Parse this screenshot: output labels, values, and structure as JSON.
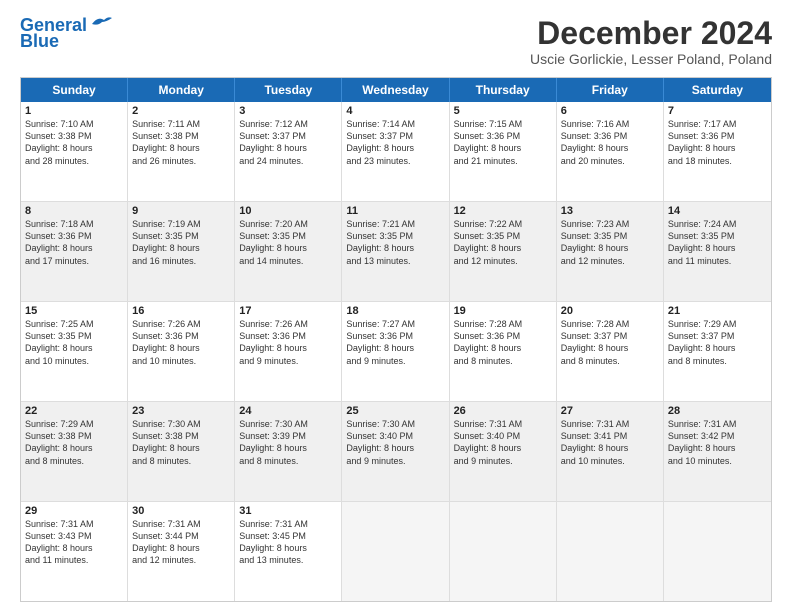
{
  "header": {
    "logo_line1": "General",
    "logo_line2": "Blue",
    "month_year": "December 2024",
    "location": "Uscie Gorlickie, Lesser Poland, Poland"
  },
  "weekdays": [
    "Sunday",
    "Monday",
    "Tuesday",
    "Wednesday",
    "Thursday",
    "Friday",
    "Saturday"
  ],
  "rows": [
    [
      {
        "day": "1",
        "lines": [
          "Sunrise: 7:10 AM",
          "Sunset: 3:38 PM",
          "Daylight: 8 hours",
          "and 28 minutes."
        ]
      },
      {
        "day": "2",
        "lines": [
          "Sunrise: 7:11 AM",
          "Sunset: 3:38 PM",
          "Daylight: 8 hours",
          "and 26 minutes."
        ]
      },
      {
        "day": "3",
        "lines": [
          "Sunrise: 7:12 AM",
          "Sunset: 3:37 PM",
          "Daylight: 8 hours",
          "and 24 minutes."
        ]
      },
      {
        "day": "4",
        "lines": [
          "Sunrise: 7:14 AM",
          "Sunset: 3:37 PM",
          "Daylight: 8 hours",
          "and 23 minutes."
        ]
      },
      {
        "day": "5",
        "lines": [
          "Sunrise: 7:15 AM",
          "Sunset: 3:36 PM",
          "Daylight: 8 hours",
          "and 21 minutes."
        ]
      },
      {
        "day": "6",
        "lines": [
          "Sunrise: 7:16 AM",
          "Sunset: 3:36 PM",
          "Daylight: 8 hours",
          "and 20 minutes."
        ]
      },
      {
        "day": "7",
        "lines": [
          "Sunrise: 7:17 AM",
          "Sunset: 3:36 PM",
          "Daylight: 8 hours",
          "and 18 minutes."
        ]
      }
    ],
    [
      {
        "day": "8",
        "lines": [
          "Sunrise: 7:18 AM",
          "Sunset: 3:36 PM",
          "Daylight: 8 hours",
          "and 17 minutes."
        ]
      },
      {
        "day": "9",
        "lines": [
          "Sunrise: 7:19 AM",
          "Sunset: 3:35 PM",
          "Daylight: 8 hours",
          "and 16 minutes."
        ]
      },
      {
        "day": "10",
        "lines": [
          "Sunrise: 7:20 AM",
          "Sunset: 3:35 PM",
          "Daylight: 8 hours",
          "and 14 minutes."
        ]
      },
      {
        "day": "11",
        "lines": [
          "Sunrise: 7:21 AM",
          "Sunset: 3:35 PM",
          "Daylight: 8 hours",
          "and 13 minutes."
        ]
      },
      {
        "day": "12",
        "lines": [
          "Sunrise: 7:22 AM",
          "Sunset: 3:35 PM",
          "Daylight: 8 hours",
          "and 12 minutes."
        ]
      },
      {
        "day": "13",
        "lines": [
          "Sunrise: 7:23 AM",
          "Sunset: 3:35 PM",
          "Daylight: 8 hours",
          "and 12 minutes."
        ]
      },
      {
        "day": "14",
        "lines": [
          "Sunrise: 7:24 AM",
          "Sunset: 3:35 PM",
          "Daylight: 8 hours",
          "and 11 minutes."
        ]
      }
    ],
    [
      {
        "day": "15",
        "lines": [
          "Sunrise: 7:25 AM",
          "Sunset: 3:35 PM",
          "Daylight: 8 hours",
          "and 10 minutes."
        ]
      },
      {
        "day": "16",
        "lines": [
          "Sunrise: 7:26 AM",
          "Sunset: 3:36 PM",
          "Daylight: 8 hours",
          "and 10 minutes."
        ]
      },
      {
        "day": "17",
        "lines": [
          "Sunrise: 7:26 AM",
          "Sunset: 3:36 PM",
          "Daylight: 8 hours",
          "and 9 minutes."
        ]
      },
      {
        "day": "18",
        "lines": [
          "Sunrise: 7:27 AM",
          "Sunset: 3:36 PM",
          "Daylight: 8 hours",
          "and 9 minutes."
        ]
      },
      {
        "day": "19",
        "lines": [
          "Sunrise: 7:28 AM",
          "Sunset: 3:36 PM",
          "Daylight: 8 hours",
          "and 8 minutes."
        ]
      },
      {
        "day": "20",
        "lines": [
          "Sunrise: 7:28 AM",
          "Sunset: 3:37 PM",
          "Daylight: 8 hours",
          "and 8 minutes."
        ]
      },
      {
        "day": "21",
        "lines": [
          "Sunrise: 7:29 AM",
          "Sunset: 3:37 PM",
          "Daylight: 8 hours",
          "and 8 minutes."
        ]
      }
    ],
    [
      {
        "day": "22",
        "lines": [
          "Sunrise: 7:29 AM",
          "Sunset: 3:38 PM",
          "Daylight: 8 hours",
          "and 8 minutes."
        ]
      },
      {
        "day": "23",
        "lines": [
          "Sunrise: 7:30 AM",
          "Sunset: 3:38 PM",
          "Daylight: 8 hours",
          "and 8 minutes."
        ]
      },
      {
        "day": "24",
        "lines": [
          "Sunrise: 7:30 AM",
          "Sunset: 3:39 PM",
          "Daylight: 8 hours",
          "and 8 minutes."
        ]
      },
      {
        "day": "25",
        "lines": [
          "Sunrise: 7:30 AM",
          "Sunset: 3:40 PM",
          "Daylight: 8 hours",
          "and 9 minutes."
        ]
      },
      {
        "day": "26",
        "lines": [
          "Sunrise: 7:31 AM",
          "Sunset: 3:40 PM",
          "Daylight: 8 hours",
          "and 9 minutes."
        ]
      },
      {
        "day": "27",
        "lines": [
          "Sunrise: 7:31 AM",
          "Sunset: 3:41 PM",
          "Daylight: 8 hours",
          "and 10 minutes."
        ]
      },
      {
        "day": "28",
        "lines": [
          "Sunrise: 7:31 AM",
          "Sunset: 3:42 PM",
          "Daylight: 8 hours",
          "and 10 minutes."
        ]
      }
    ],
    [
      {
        "day": "29",
        "lines": [
          "Sunrise: 7:31 AM",
          "Sunset: 3:43 PM",
          "Daylight: 8 hours",
          "and 11 minutes."
        ]
      },
      {
        "day": "30",
        "lines": [
          "Sunrise: 7:31 AM",
          "Sunset: 3:44 PM",
          "Daylight: 8 hours",
          "and 12 minutes."
        ]
      },
      {
        "day": "31",
        "lines": [
          "Sunrise: 7:31 AM",
          "Sunset: 3:45 PM",
          "Daylight: 8 hours",
          "and 13 minutes."
        ]
      },
      {
        "day": "",
        "lines": []
      },
      {
        "day": "",
        "lines": []
      },
      {
        "day": "",
        "lines": []
      },
      {
        "day": "",
        "lines": []
      }
    ]
  ]
}
